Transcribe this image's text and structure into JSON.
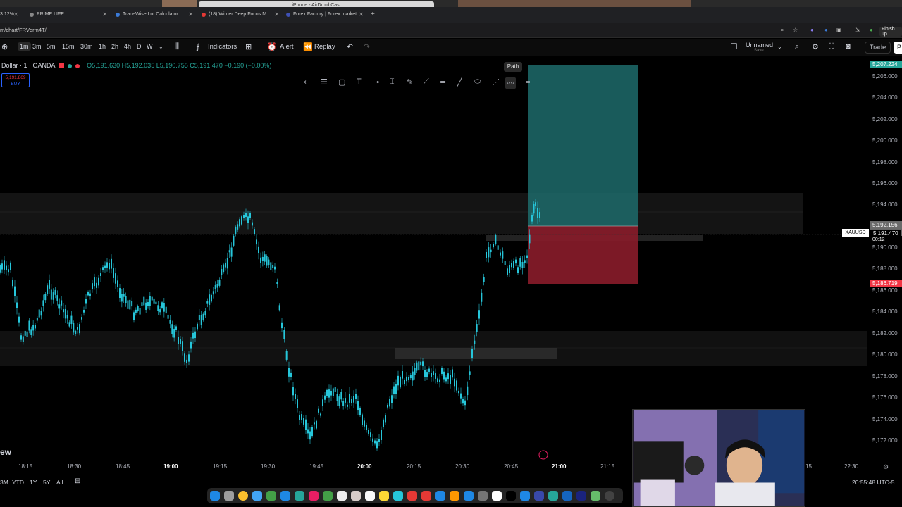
{
  "browser": {
    "airdroid_title": "iPhone - AirDroid Cast",
    "tabs": [
      {
        "label": "3.12%",
        "fav": "#4caf50"
      },
      {
        "label": "PRIME LIFE",
        "fav": "#888888"
      },
      {
        "label": "TradeWise Lot Calculator",
        "fav": "#3b7bd8"
      },
      {
        "label": "(18) Winter Deep Focus M",
        "fav": "#e53935"
      },
      {
        "label": "Forex Factory | Forex market",
        "fav": "#3f51b5"
      }
    ],
    "url": "m/chart/FRVdrm4T/",
    "finish_label": "Finish up"
  },
  "toolbar": {
    "timeframes": [
      "1m",
      "3m",
      "5m",
      "15m",
      "30m",
      "1h",
      "2h",
      "4h",
      "D",
      "W"
    ],
    "active_timeframe": "1m",
    "indicators_label": "Indicators",
    "alert_label": "Alert",
    "replay_label": "Replay",
    "layout_name": "Unnamed",
    "layout_sub": "Save",
    "trade_label": "Trade",
    "p_label": "P"
  },
  "symbol": {
    "name": "Dollar · 1 · OANDA",
    "open": "O5,191.630",
    "high": "H5,192.035",
    "low": "L5,190.755",
    "close": "C5,191.470",
    "change": "−0.190 (−0.00%)",
    "buy_price": "5,191.869",
    "buy_label": "BUY",
    "ticker_tag": "XAUUSD"
  },
  "drawing": {
    "tooltip": "Path"
  },
  "price_scale": {
    "labels": [
      "5,206.000",
      "5,204.000",
      "5,202.000",
      "5,200.000",
      "5,198.000",
      "5,196.000",
      "5,194.000",
      "5,190.000",
      "5,188.000",
      "5,186.000",
      "5,184.000",
      "5,182.000",
      "5,180.000",
      "5,178.000",
      "5,176.000",
      "5,174.000",
      "5,172.000"
    ],
    "target_tag": "5,207.224",
    "entry_tag": "5,192.156",
    "current_tag": "5,191.470",
    "countdown": "00:12",
    "stop_tag": "5,186.719"
  },
  "time_axis": {
    "labels": [
      "18:15",
      "18:30",
      "18:45",
      "19:00",
      "19:15",
      "19:30",
      "19:45",
      "20:00",
      "20:15",
      "20:30",
      "20:45",
      "21:00",
      "21:15",
      "15",
      "22:30"
    ],
    "bold": [
      "19:00",
      "20:00",
      "21:00"
    ]
  },
  "bottom": {
    "ranges": [
      "3M",
      "YTD",
      "1Y",
      "5Y",
      "All"
    ],
    "clock": "20:55:48 UTC-5",
    "watermark": "ew"
  },
  "colors": {
    "up": "#26c6da",
    "profit_zone": "#1d6b6b",
    "loss_zone": "#8a1c2a",
    "target_tag": "#26a69a",
    "stop_tag": "#f23645"
  }
}
